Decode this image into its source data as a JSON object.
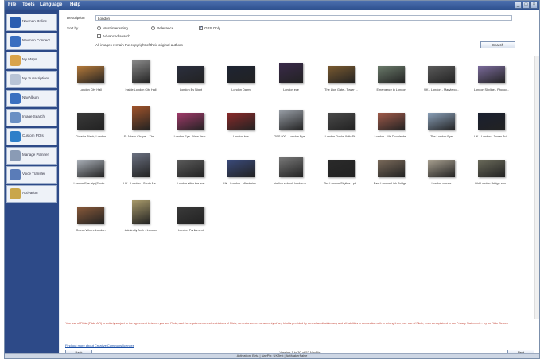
{
  "menubar": {
    "items": [
      "File",
      "Tools",
      "Language",
      "Help"
    ]
  },
  "window_buttons": [
    "_",
    "□",
    "×"
  ],
  "sidebar": {
    "items": [
      {
        "label": "Navman Online",
        "icon": "globe-icon",
        "color": "#2a5db0"
      },
      {
        "label": "Navman Connect",
        "icon": "connect-icon",
        "color": "#3a6fc0"
      },
      {
        "label": "My Maps",
        "icon": "maps-icon",
        "color": "#d9a34a"
      },
      {
        "label": "My Subscriptions",
        "icon": "subscriptions-icon",
        "color": "#b8c4d6"
      },
      {
        "label": "NavAlbum",
        "icon": "album-icon",
        "color": "#3a6fc0"
      },
      {
        "label": "Image Search",
        "icon": "image-search-icon",
        "color": "#6a8fc4"
      },
      {
        "label": "Custom POIs",
        "icon": "poi-icon",
        "color": "#2e7fc9"
      },
      {
        "label": "Manage Planner",
        "icon": "planner-icon",
        "color": "#8a9bb5"
      },
      {
        "label": "Voice Transfer",
        "icon": "voice-icon",
        "color": "#5a7cb8"
      },
      {
        "label": "Activation",
        "icon": "activation-icon",
        "color": "#c9a64a"
      }
    ]
  },
  "search": {
    "description_label": "Description",
    "description_value": "London",
    "sort_by_label": "Sort by",
    "sort_options": [
      {
        "label": "Most interesting",
        "selected": false
      },
      {
        "label": "Relevance",
        "selected": true
      }
    ],
    "gps_only_label": "GPS Only",
    "gps_only_checked": true,
    "advanced_label": "Advanced search",
    "advanced_checked": false,
    "copyright_note": "All images remain the copyright of their original authors",
    "search_button": "Search"
  },
  "results": [
    {
      "caption": "London City Hall",
      "color": "#b57a3a"
    },
    {
      "caption": "Inside London City Hall",
      "color": "#8c8c8c"
    },
    {
      "caption": "London By Night",
      "color": "#2b2f3e"
    },
    {
      "caption": "London Dawn",
      "color": "#1e2433"
    },
    {
      "caption": "London eye",
      "color": "#3a2a4a"
    },
    {
      "caption": "The Lion Gate - Tower ...",
      "color": "#7a5a30"
    },
    {
      "caption": "Emergency in London",
      "color": "#6a7a6a"
    },
    {
      "caption": "UK - London - Marylebo...",
      "color": "#5a5a5a"
    },
    {
      "caption": "London Skyline - Photoc...",
      "color": "#7a6a9a"
    },
    {
      "caption": "Chester Black, London",
      "color": "#3a3a3a"
    },
    {
      "caption": "St John's Chapel - The ...",
      "color": "#a0532a"
    },
    {
      "caption": "London Eye - New Year...",
      "color": "#a03a6a"
    },
    {
      "caption": "London bus",
      "color": "#8a2a2a"
    },
    {
      "caption": "GPS 800 - London Eye ...",
      "color": "#9aa0a8"
    },
    {
      "caption": "London Docks With St...",
      "color": "#4a4a4a"
    },
    {
      "caption": "London - UK Double de...",
      "color": "#a05a4a"
    },
    {
      "caption": "The London Eye",
      "color": "#8aa0b8"
    },
    {
      "caption": "UK - London - Tower Bri...",
      "color": "#1a2030"
    },
    {
      "caption": "London Eye trip (South ...",
      "color": "#aab0b8"
    },
    {
      "caption": "UK - London - South Ba...",
      "color": "#6a7080"
    },
    {
      "caption": "London after the war",
      "color": "#5a5a5a"
    },
    {
      "caption": "UK - London - Westmins...",
      "color": "#3a4a7a"
    },
    {
      "caption": "pimlico school. london u...",
      "color": "#7a7a7a"
    },
    {
      "caption": "The London Skyline - ph...",
      "color": "#2a2a2a"
    },
    {
      "caption": "East London Link Bridge...",
      "color": "#7a6a5a"
    },
    {
      "caption": "London curves",
      "color": "#a8a090"
    },
    {
      "caption": "Old London Bridge abo...",
      "color": "#6a6a5a"
    },
    {
      "caption": "Guess Where London",
      "color": "#8a5a3a"
    },
    {
      "caption": "Admiralty Arch - London",
      "color": "#a89a6a"
    },
    {
      "caption": "London Parliament",
      "color": "#3a3a3a"
    }
  ],
  "notice": "Your use of Flickr (Flickr API) is entirely subject to the agreement between you and Flickr, and the requirements and restrictions of Flickr, no endorsement or warranty of any kind is provided by us and we disclaim any and all liabilities in connection with or arising from your use of Flickr; even as explained in our Privacy Statement ... by us Flickr Search",
  "cc_link": "Find out more about Creative Commons licences",
  "nav": {
    "back": "Back",
    "next": "Next",
    "viewing": "Viewing 1 to 30 of 52 NavPix"
  },
  "status": "Activation: Beta  |  NavPix: UKTest  |  AutMakerFalse"
}
